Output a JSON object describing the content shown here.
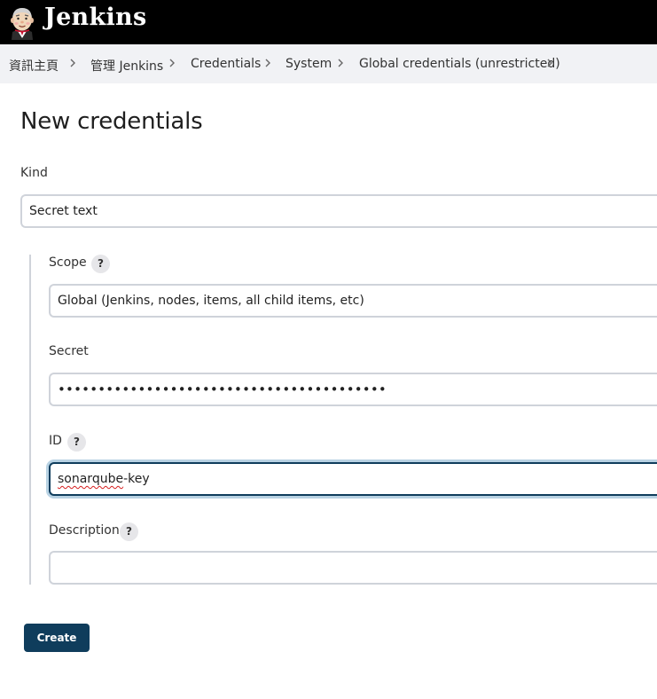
{
  "header": {
    "brand": "Jenkins",
    "logo_icon": "jenkins-butler-icon"
  },
  "breadcrumb": {
    "items": [
      "資訊主頁",
      "管理 Jenkins",
      "Credentials",
      "System",
      "Global credentials (unrestricted)"
    ],
    "separator_icon": "chevron-right-icon"
  },
  "page": {
    "title": "New credentials"
  },
  "form": {
    "kind": {
      "label": "Kind",
      "value": "Secret text"
    },
    "scope": {
      "label": "Scope",
      "help": "?",
      "value": "Global (Jenkins, nodes, items, all child items, etc)"
    },
    "secret": {
      "label": "Secret",
      "value": "•••••••••••••••••••••••••••••••••••••••••"
    },
    "id": {
      "label": "ID",
      "help": "?",
      "value_misspelled": "sonarqube",
      "value_rest": "-key"
    },
    "description": {
      "label": "Description",
      "help": "?",
      "value": ""
    },
    "create_label": "Create"
  },
  "colors": {
    "header_bg": "#000000",
    "breadcrumb_bg": "#f1f2f5",
    "primary_button": "#0f3d5c",
    "focus_ring": "#b8d2e3",
    "input_border": "#cfd3da"
  }
}
